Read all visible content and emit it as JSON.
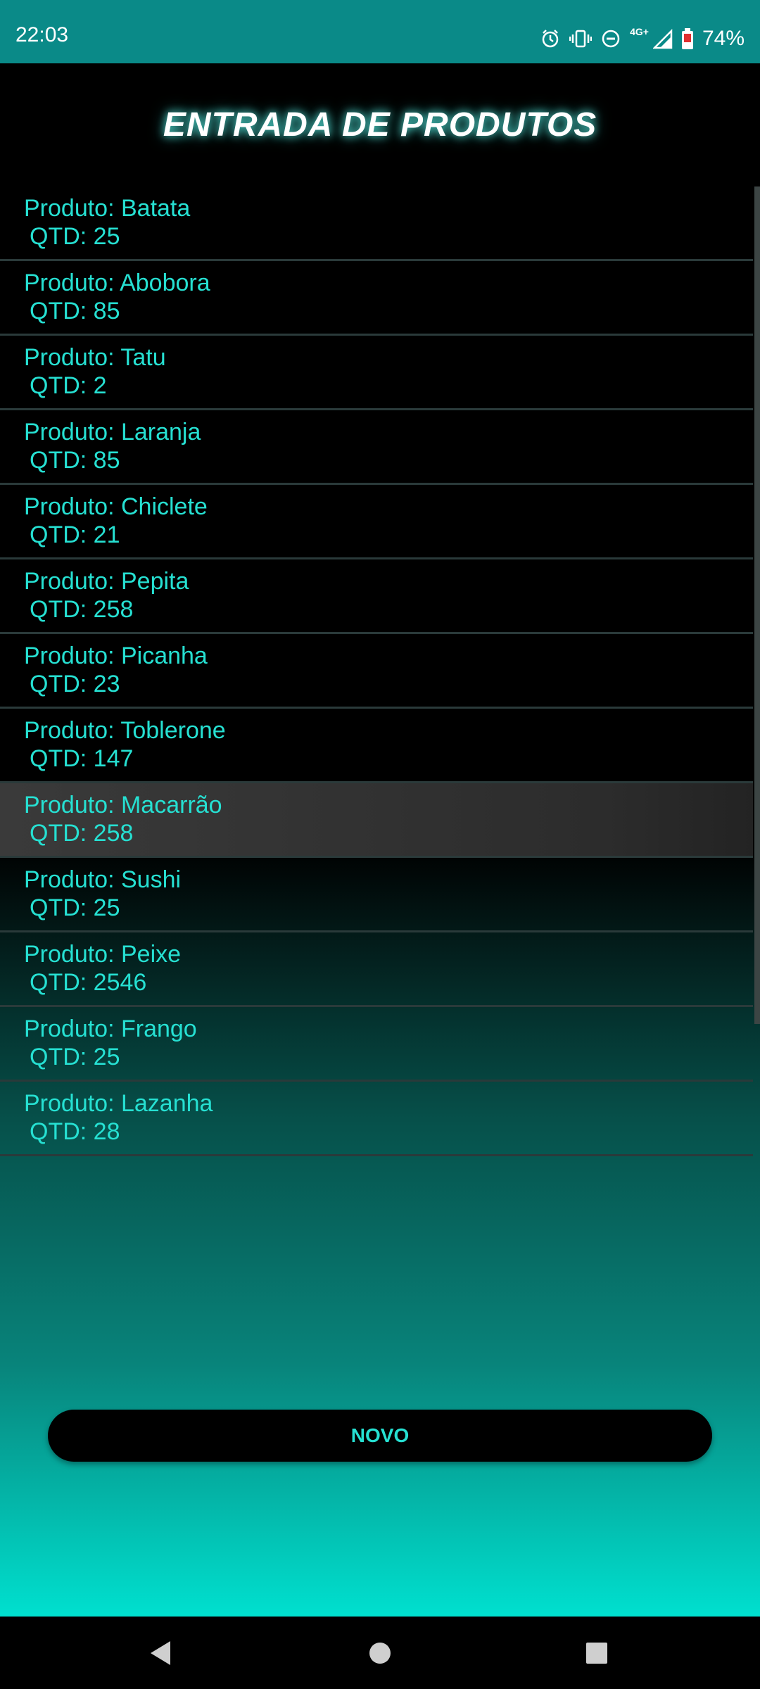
{
  "status_bar": {
    "time": "22:03",
    "network_type": "4G+",
    "battery_percent": "74%",
    "icons": [
      "alarm-icon",
      "vibrate-icon",
      "do-not-disturb-icon",
      "signal-icon",
      "battery-icon"
    ]
  },
  "page": {
    "title": "ENTRADA DE PRODUTOS"
  },
  "products": [
    {
      "name": "Produto: Batata",
      "qty": "QTD: 25"
    },
    {
      "name": "Produto: Abobora",
      "qty": "QTD: 85"
    },
    {
      "name": "Produto: Tatu",
      "qty": "QTD: 2"
    },
    {
      "name": "Produto: Laranja",
      "qty": "QTD: 85"
    },
    {
      "name": "Produto: Chiclete",
      "qty": "QTD: 21"
    },
    {
      "name": "Produto: Pepita",
      "qty": "QTD: 258"
    },
    {
      "name": "Produto: Picanha",
      "qty": "QTD: 23"
    },
    {
      "name": "Produto: Toblerone",
      "qty": "QTD: 147"
    },
    {
      "name": "Produto: Macarrão",
      "qty": "QTD: 258"
    },
    {
      "name": "Produto: Sushi",
      "qty": "QTD: 25"
    },
    {
      "name": "Produto: Peixe",
      "qty": "QTD: 2546"
    },
    {
      "name": "Produto: Frango",
      "qty": "QTD: 25"
    },
    {
      "name": "Produto: Lazanha",
      "qty": "QTD: 28"
    }
  ],
  "actions": {
    "new_label": "NOVO"
  },
  "nav_bar": {
    "icons": [
      "back-icon",
      "home-icon",
      "recents-icon"
    ]
  },
  "colors": {
    "accent": "#26e0d2",
    "status_bar": "#0a8a88"
  }
}
